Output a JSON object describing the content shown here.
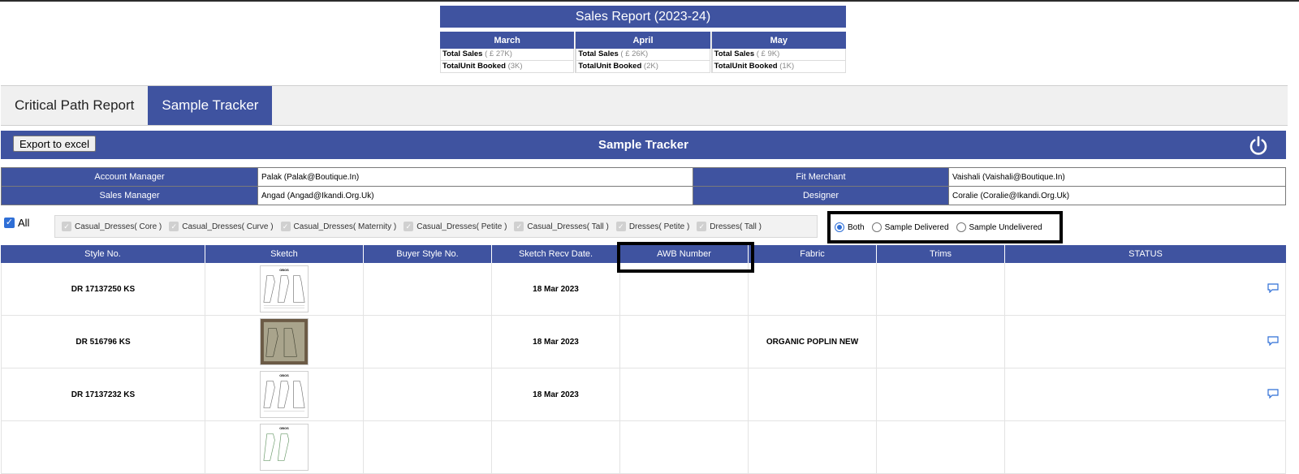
{
  "sales_report": {
    "title": "Sales Report (2023-24)",
    "months": [
      {
        "name": "March",
        "total_sales_label": "Total Sales",
        "total_sales_value": "( £ 27K)",
        "units_label": "TotalUnit Booked",
        "units_value": "(3K)"
      },
      {
        "name": "April",
        "total_sales_label": "Total Sales",
        "total_sales_value": "( £ 26K)",
        "units_label": "TotalUnit Booked",
        "units_value": "(2K)"
      },
      {
        "name": "May",
        "total_sales_label": "Total Sales",
        "total_sales_value": "( £ 9K)",
        "units_label": "TotalUnit Booked",
        "units_value": "(1K)"
      }
    ]
  },
  "tabs": [
    {
      "label": "Critical Path Report",
      "active": false
    },
    {
      "label": "Sample Tracker",
      "active": true
    }
  ],
  "tracker": {
    "export_label": "Export to excel",
    "title": "Sample Tracker",
    "power_icon": "power-icon"
  },
  "info": {
    "account_manager_label": "Account Manager",
    "account_manager_value": "Palak (Palak@Boutique.In)",
    "fit_merchant_label": "Fit Merchant",
    "fit_merchant_value": "Vaishali (Vaishali@Boutique.In)",
    "sales_manager_label": "Sales Manager",
    "sales_manager_value": "Angad (Angad@Ikandi.Org.Uk)",
    "designer_label": "Designer",
    "designer_value": "Coralie (Coralie@Ikandi.Org.Uk)"
  },
  "filters": {
    "all_label": "All",
    "all_checked": true,
    "categories": [
      "Casual_Dresses( Core )",
      "Casual_Dresses( Curve )",
      "Casual_Dresses( Maternity )",
      "Casual_Dresses( Petite )",
      "Casual_Dresses( Tall )",
      "Dresses( Petite )",
      "Dresses( Tall )"
    ],
    "radios": [
      {
        "label": "Both",
        "selected": true
      },
      {
        "label": "Sample Delivered",
        "selected": false
      },
      {
        "label": "Sample Undelivered",
        "selected": false
      }
    ]
  },
  "grid": {
    "headers": [
      "Style No.",
      "Sketch",
      "Buyer Style No.",
      "Sketch Recv Date.",
      "AWB Number",
      "Fabric",
      "Trims",
      "STATUS"
    ],
    "rows": [
      {
        "style_no": "DR 17137250 KS",
        "buyer_style_no": "",
        "recv_date": "18 Mar 2023",
        "awb": "",
        "fabric": "",
        "trims": "",
        "status": ""
      },
      {
        "style_no": "DR 516796 KS",
        "buyer_style_no": "",
        "recv_date": "18 Mar 2023",
        "awb": "",
        "fabric": "ORGANIC POPLIN NEW",
        "trims": "",
        "status": ""
      },
      {
        "style_no": "DR 17137232 KS",
        "buyer_style_no": "",
        "recv_date": "18 Mar 2023",
        "awb": "",
        "fabric": "",
        "trims": "",
        "status": ""
      },
      {
        "style_no": "",
        "buyer_style_no": "",
        "recv_date": "",
        "awb": "",
        "fabric": "",
        "trims": "",
        "status": ""
      }
    ]
  },
  "colors": {
    "primary": "#3f53a0",
    "accent": "#2f6fd6",
    "highlight_border": "#000000"
  }
}
